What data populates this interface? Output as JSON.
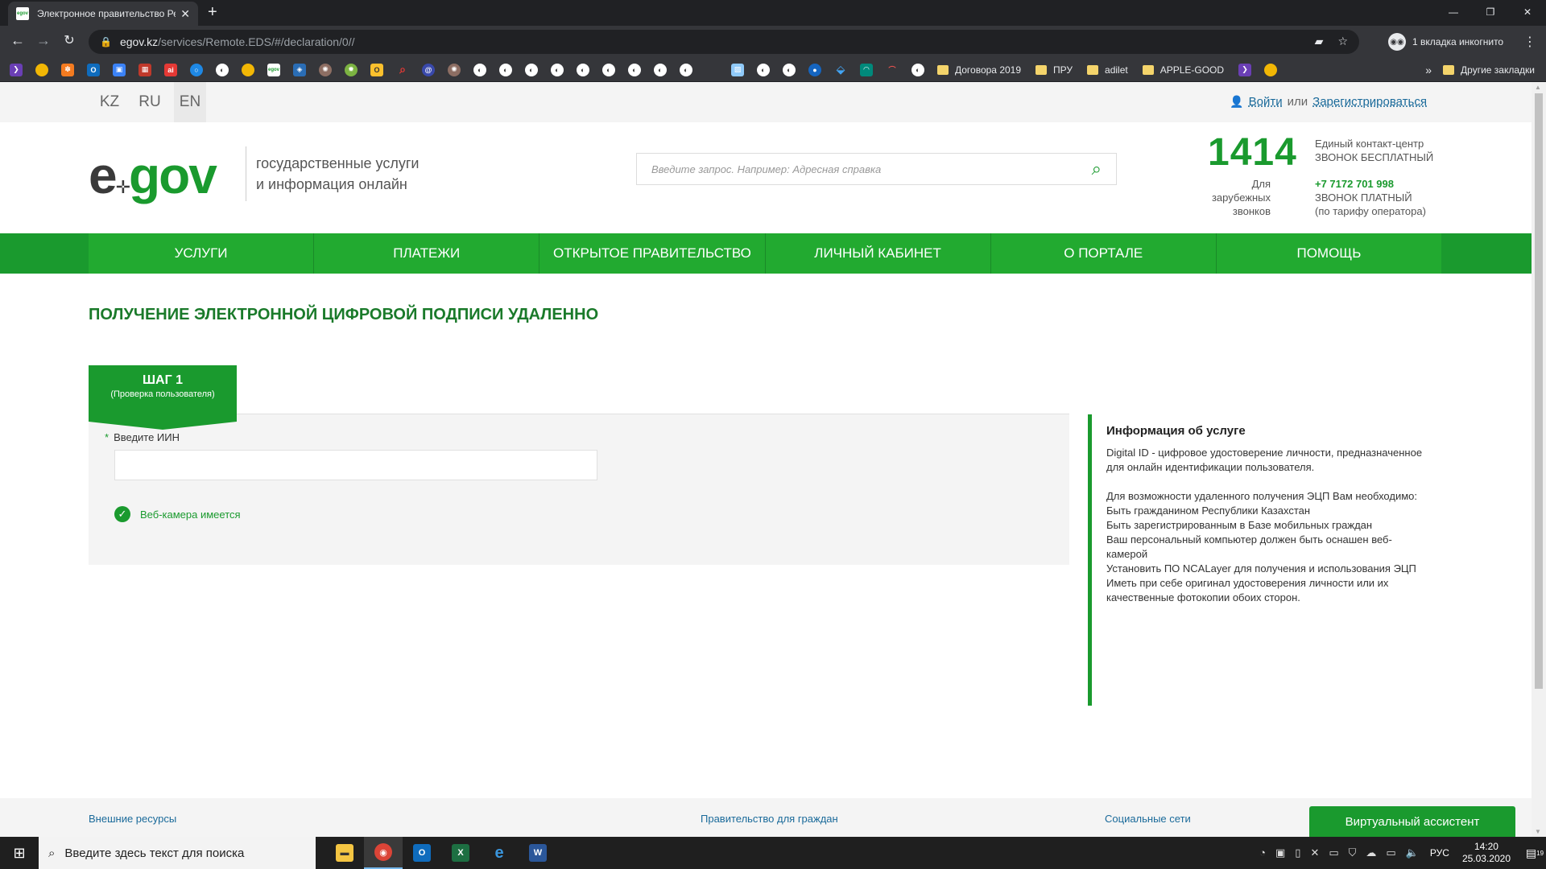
{
  "browser": {
    "tab_title": "Электронное правительство Ре",
    "tab_favicon_text": "egov",
    "url_host": "egov.kz",
    "url_path": "/services/Remote.EDS/#/declaration/0//",
    "incognito_label": "1 вкладка инкогнито",
    "bookmark_folders": [
      "Договора 2019",
      "ПРУ",
      "adilet",
      "APPLE-GOOD"
    ],
    "more_bookmarks": "»",
    "other_bookmarks": "Другие закладки"
  },
  "langbar": {
    "languages": [
      "KZ",
      "RU",
      "EN"
    ],
    "login": "Войти",
    "or": "или",
    "register": "Зарегистрироваться"
  },
  "header": {
    "logo_e": "e",
    "logo_gov": "gov",
    "tagline_line1": "государственные услуги",
    "tagline_line2": "и информация онлайн",
    "search_placeholder": "Введите запрос. Например: Адресная справка",
    "contact_number": "1414",
    "contact_center": "Единый контакт-центр",
    "free_call": "ЗВОНОК БЕСПЛАТНЫЙ",
    "foreign_line1": "Для зарубежных",
    "foreign_line2": "звонков",
    "foreign_phone": "+7 7172 701 998",
    "paid_call": "ЗВОНОК ПЛАТНЫЙ",
    "operator_rate": "(по тарифу оператора)"
  },
  "nav": {
    "items": [
      "УСЛУГИ",
      "ПЛАТЕЖИ",
      "ОТКРЫТОЕ ПРАВИТЕЛЬСТВО",
      "ЛИЧНЫЙ КАБИНЕТ",
      "О ПОРТАЛЕ",
      "ПОМОЩЬ"
    ]
  },
  "main": {
    "title": "ПОЛУЧЕНИЕ ЭЛЕКТРОННОЙ ЦИФРОВОЙ ПОДПИСИ УДАЛЕННО",
    "step_title": "ШАГ 1",
    "step_subtitle": "(Проверка пользователя)",
    "iin_required_mark": "*",
    "iin_label": "Введите ИИН",
    "iin_value": "",
    "webcam_status": "Веб-камера имеется"
  },
  "info": {
    "title": "Информация об услуге",
    "paragraph1": "Digital ID - цифровое удостоверение личности, предназначенное для онлайн идентификации пользователя.",
    "requirements_intro": "Для возможности удаленного получения ЭЦП Вам необходимо:",
    "requirements": [
      "Быть гражданином Республики Казахстан",
      "Быть зарегистрированным в Базе мобильных граждан",
      "Ваш персональный компьютер должен быть оснашен веб-камерой",
      "Установить ПО NCALayer для получения и использования ЭЦП",
      "Иметь при себе оригинал удостоверения личности или их качественные фотокопии обоих сторон."
    ]
  },
  "footer": {
    "external": "Внешние ресурсы",
    "gov_for_citizens": "Правительство для граждан",
    "social": "Социальные сети",
    "assistant": "Виртуальный ассистент"
  },
  "taskbar": {
    "search_placeholder": "Введите здесь текст для поиска",
    "lang": "РУС",
    "time": "14:20",
    "date": "25.03.2020",
    "notification_count": "19"
  },
  "colors": {
    "brand_green": "#1a9a2e",
    "nav_green": "#22aa30"
  }
}
